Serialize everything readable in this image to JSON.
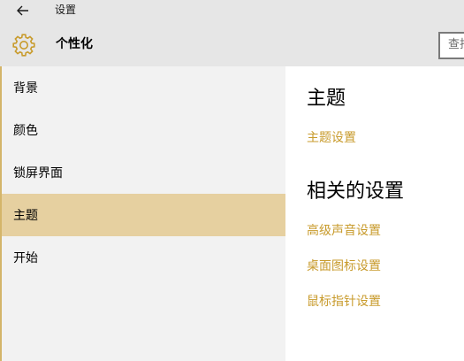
{
  "titlebar": {
    "title": "设置",
    "back_icon": "back-arrow-icon"
  },
  "header": {
    "icon": "gear-icon",
    "title": "个性化",
    "search_placeholder": "查找设置"
  },
  "sidebar": {
    "items": [
      {
        "label": "背景",
        "selected": false
      },
      {
        "label": "颜色",
        "selected": false
      },
      {
        "label": "锁屏界面",
        "selected": false
      },
      {
        "label": "主题",
        "selected": true
      },
      {
        "label": "开始",
        "selected": false
      }
    ]
  },
  "main": {
    "theme_heading": "主题",
    "theme_settings_link": "主题设置",
    "related_heading": "相关的设置",
    "related_links": [
      "高级声音设置",
      "桌面图标设置",
      "鼠标指针设置"
    ]
  },
  "colors": {
    "accent": "#c89b2c",
    "selected_bg": "#e6d0a0",
    "header_bg": "#e6e6e6",
    "sidebar_bg": "#f2f2f2"
  }
}
